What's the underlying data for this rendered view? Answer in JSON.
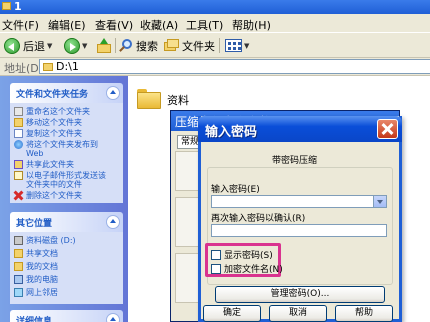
{
  "window": {
    "title": "1"
  },
  "menu": {
    "items": [
      "文件(F)",
      "编辑(E)",
      "查看(V)",
      "收藏(A)",
      "工具(T)",
      "帮助(H)"
    ]
  },
  "toolbar": {
    "back_label": "后退",
    "search_label": "搜索",
    "folders_label": "文件夹"
  },
  "address": {
    "label": "地址(D)",
    "value": "D:\\1"
  },
  "sidebar": {
    "tasks": {
      "title": "文件和文件夹任务",
      "items": [
        {
          "label": "重命名这个文件夹",
          "icon": "rename-icon"
        },
        {
          "label": "移动这个文件夹",
          "icon": "move-icon"
        },
        {
          "label": "复制这个文件夹",
          "icon": "copy-icon"
        },
        {
          "label": "将这个文件夹发布到",
          "label2": "Web",
          "icon": "web-icon"
        },
        {
          "label": "共享此文件夹",
          "icon": "share-icon"
        },
        {
          "label": "以电子邮件形式发送该",
          "label2": "文件夹中的文件",
          "icon": "mail-icon"
        },
        {
          "label": "删除这个文件夹",
          "icon": "delete-icon"
        }
      ]
    },
    "places": {
      "title": "其它位置",
      "items": [
        {
          "label": "资料磁盘 (D:)",
          "icon": "disk-icon"
        },
        {
          "label": "共享文档",
          "icon": "shared-docs-icon"
        },
        {
          "label": "我的文档",
          "icon": "my-docs-icon"
        },
        {
          "label": "我的电脑",
          "icon": "computer-icon"
        },
        {
          "label": "网上邻居",
          "icon": "network-icon"
        }
      ]
    },
    "details": {
      "title": "详细信息"
    }
  },
  "main": {
    "folder_name": "资料"
  },
  "bg_dialog": {
    "title": "压缩文件名和参数",
    "tab": "常规"
  },
  "dialog": {
    "title": "输入密码",
    "heading": "带密码压缩",
    "password_label": "输入密码(E)",
    "password_value": "",
    "confirm_label": "再次输入密码以确认(R)",
    "confirm_value": "",
    "show_password_label": "显示密码(S)",
    "encrypt_names_label": "加密文件名(N)",
    "show_password_checked": false,
    "encrypt_names_checked": false,
    "manage_button": "管理密码(O)...",
    "ok_button": "确定",
    "cancel_button": "取消",
    "help_button": "帮助",
    "highlight_color": "#d9338f"
  }
}
